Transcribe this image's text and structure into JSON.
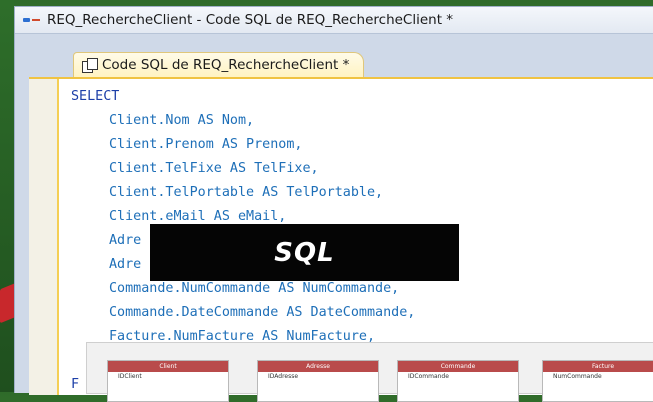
{
  "window": {
    "title": "REQ_RechercheClient - Code SQL de REQ_RechercheClient *"
  },
  "tab": {
    "label": "Code SQL de REQ_RechercheClient *"
  },
  "code": {
    "select": "SELECT",
    "lines": [
      "Client.Nom AS Nom,",
      "Client.Prenom AS Prenom,",
      "Client.TelFixe AS TelFixe,",
      "Client.TelPortable AS TelPortable,",
      "Client.eMail AS eMail,",
      "Adre",
      "Adre",
      "Commande.NumCommande AS NumCommande,",
      "Commande.DateCommande AS DateCommande,",
      "Facture.NumFacture AS NumFacture,"
    ],
    "from_fragment": "F"
  },
  "overlay": {
    "label": "SQL"
  },
  "diagram": {
    "tables": [
      {
        "name": "Client",
        "first_field": "IDClient"
      },
      {
        "name": "Adresse",
        "first_field": "IDAdresse"
      },
      {
        "name": "Commande",
        "first_field": "IDCommande"
      },
      {
        "name": "Facture",
        "first_field": "NumCommande"
      }
    ]
  },
  "colors": {
    "accent": "#f0c342",
    "keyword": "#1d3fa8",
    "overlay_bg": "#050505",
    "table_header": "#b94b4b"
  }
}
